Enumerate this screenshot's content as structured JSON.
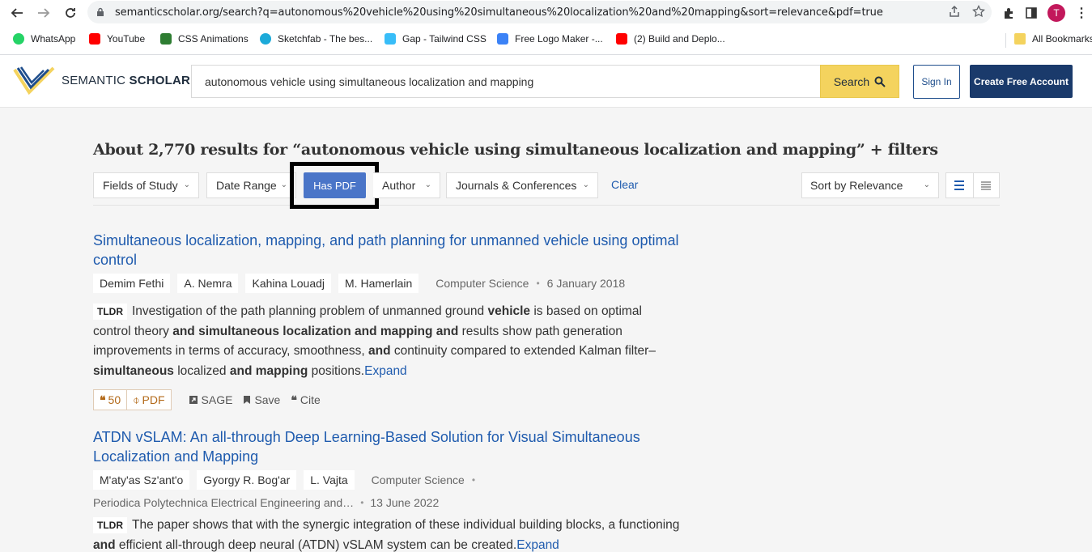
{
  "browser": {
    "url": "semanticscholar.org/search?q=autonomous%20vehicle%20using%20simultaneous%20localization%20and%20mapping&sort=relevance&pdf=true",
    "avatar_letter": "T",
    "bookmarks": [
      {
        "label": "WhatsApp",
        "color": "#25d366"
      },
      {
        "label": "YouTube",
        "color": "#ff0000"
      },
      {
        "label": "CSS Animations",
        "color": "#2e7d32"
      },
      {
        "label": "Sketchfab - The bes...",
        "color": "#1caad9"
      },
      {
        "label": "Gap - Tailwind CSS",
        "color": "#38bdf8"
      },
      {
        "label": "Free Logo Maker -...",
        "color": "#3b82f6"
      },
      {
        "label": "(2) Build and Deplo...",
        "color": "#ff0000"
      }
    ],
    "all_bookmarks": "All Bookmarks"
  },
  "header": {
    "logo_prefix": "SEMANTIC",
    "logo_suffix": "SCHOLAR",
    "search_value": "autonomous vehicle using simultaneous localization and mapping",
    "search_button": "Search",
    "signin": "Sign In",
    "create_account": "Create Free Account"
  },
  "results_heading": "About 2,770 results for “autonomous vehicle using simultaneous localization and mapping” + filters",
  "filters": {
    "fields_of_study": "Fields of Study",
    "date_range": "Date Range",
    "has_pdf": "Has PDF",
    "author": "Author",
    "journals": "Journals & Conferences",
    "clear": "Clear",
    "sort": "Sort by Relevance"
  },
  "results": [
    {
      "title": "Simultaneous localization, mapping, and path planning for unmanned vehicle using optimal control",
      "authors": [
        "Demim Fethi",
        "A. Nemra",
        "Kahina Louadj",
        "M. Hamerlain"
      ],
      "field": "Computer Science",
      "date": "6 January 2018",
      "tldr_label": "TLDR",
      "tldr_parts": [
        {
          "t": "Investigation of the path planning problem of unmanned ground ",
          "b": false
        },
        {
          "t": "vehicle",
          "b": true
        },
        {
          "t": " is based on optimal control theory ",
          "b": false
        },
        {
          "t": "and simultaneous localization and mapping and",
          "b": true
        },
        {
          "t": " results show path generation improvements in terms of accuracy, smoothness, ",
          "b": false
        },
        {
          "t": "and",
          "b": true
        },
        {
          "t": " continuity compared to extended Kalman filter–",
          "b": false
        },
        {
          "t": "simultaneous",
          "b": true
        },
        {
          "t": " localized ",
          "b": false
        },
        {
          "t": "and mapping",
          "b": true
        },
        {
          "t": " positions.",
          "b": false
        }
      ],
      "expand": "Expand",
      "citations": "50",
      "pdf": "PDF",
      "source": "SAGE",
      "save": "Save",
      "cite": "Cite"
    },
    {
      "title": "ATDN vSLAM: An all-through Deep Learning-Based Solution for Visual Simultaneous Localization and Mapping",
      "authors": [
        "M'aty'as Sz'ant'o",
        "Gyorgy R. Bog'ar",
        "L. Vajta"
      ],
      "field": "Computer Science",
      "venue": "Periodica Polytechnica Electrical Engineering and…",
      "date": "13 June 2022",
      "tldr_label": "TLDR",
      "tldr_parts": [
        {
          "t": "The paper shows that with the synergic integration of these individual building blocks, a functioning ",
          "b": false
        },
        {
          "t": "and",
          "b": true
        },
        {
          "t": " efficient all-through deep neural (ATDN) vSLAM system can be created.",
          "b": false
        }
      ],
      "expand": "Expand"
    }
  ]
}
